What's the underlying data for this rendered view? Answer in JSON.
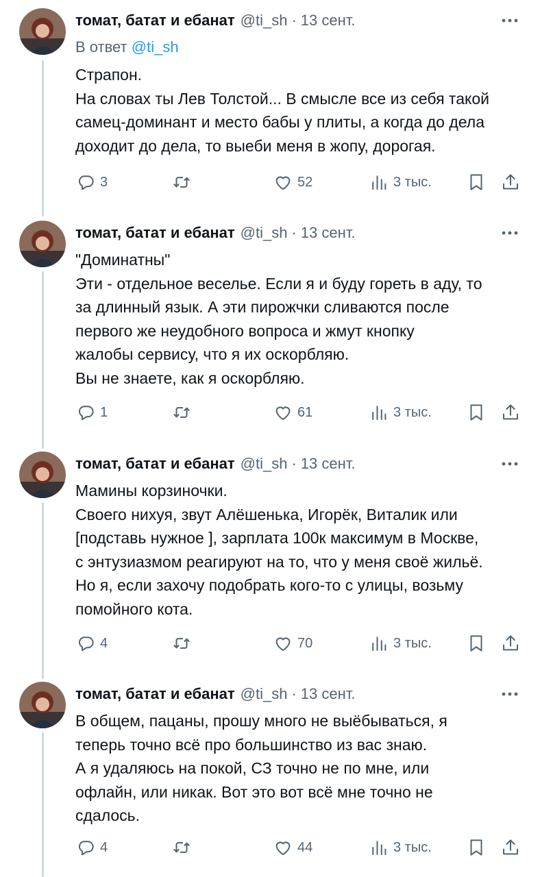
{
  "colors": {
    "text": "#0f1419",
    "secondary": "#536471",
    "link": "#1d9bf0",
    "thread_line": "#cfd9de"
  },
  "icons": [
    "more-icon",
    "reply-icon",
    "retweet-icon",
    "like-icon",
    "views-icon",
    "bookmark-icon",
    "share-icon"
  ],
  "tweets": [
    {
      "author": {
        "name": "томат, батат и ебанат",
        "handle": "@ti_sh"
      },
      "separator": "·",
      "time": "13 сент.",
      "reply_to": {
        "prefix": "В ответ",
        "mention": "@ti_sh"
      },
      "lines": [
        "Страпон.",
        "На словах ты Лев Толстой... В смысле все из себя такой",
        "самец-доминант и место бабы у плиты, а когда до дела",
        "доходит до дела, то выеби меня в жопу, дорогая."
      ],
      "stats": {
        "replies": "3",
        "retweets": "",
        "likes": "52",
        "views": "3 тыс."
      }
    },
    {
      "author": {
        "name": "томат, батат и ебанат",
        "handle": "@ti_sh"
      },
      "separator": "·",
      "time": "13 сент.",
      "lines": [
        "\"Доминатны\"",
        "Эти - отдельное веселье. Если я и буду гореть в аду, то",
        "за длинный язык. А эти пирожчки сливаются после",
        "первого же неудобного вопроса и жмут кнопку",
        "жалобы сервису, что я их оскорбляю.",
        "Вы не знаете, как я оскорбляю."
      ],
      "stats": {
        "replies": "1",
        "retweets": "",
        "likes": "61",
        "views": "3 тыс."
      }
    },
    {
      "author": {
        "name": "томат, батат и ебанат",
        "handle": "@ti_sh"
      },
      "separator": "·",
      "time": "13 сент.",
      "lines": [
        "Мамины корзиночки.",
        "Своего нихуя, звут Алёшенька, Игорёк, Виталик или",
        "[подставь нужное ], зарплата 100к максимум в Москве,",
        "с энтузиазмом реагируют на то, что у меня своё жильё.",
        "Но я, если захочу подобрать кого-то с улицы, возьму",
        "помойного кота."
      ],
      "stats": {
        "replies": "4",
        "retweets": "",
        "likes": "70",
        "views": "3 тыс."
      }
    },
    {
      "author": {
        "name": "томат, батат и ебанат",
        "handle": "@ti_sh"
      },
      "separator": "·",
      "time": "13 сент.",
      "lines": [
        "В общем, пацаны, прошу много не выёбываться, я",
        "теперь точно всё про большинство из вас знаю.",
        "А я удаляюсь на покой, СЗ точно не по мне, или",
        "офлайн, или никак. Вот это вот всё мне точно не",
        "сдалось."
      ],
      "stats": {
        "replies": "4",
        "retweets": "",
        "likes": "44",
        "views": "3 тыс."
      }
    }
  ]
}
